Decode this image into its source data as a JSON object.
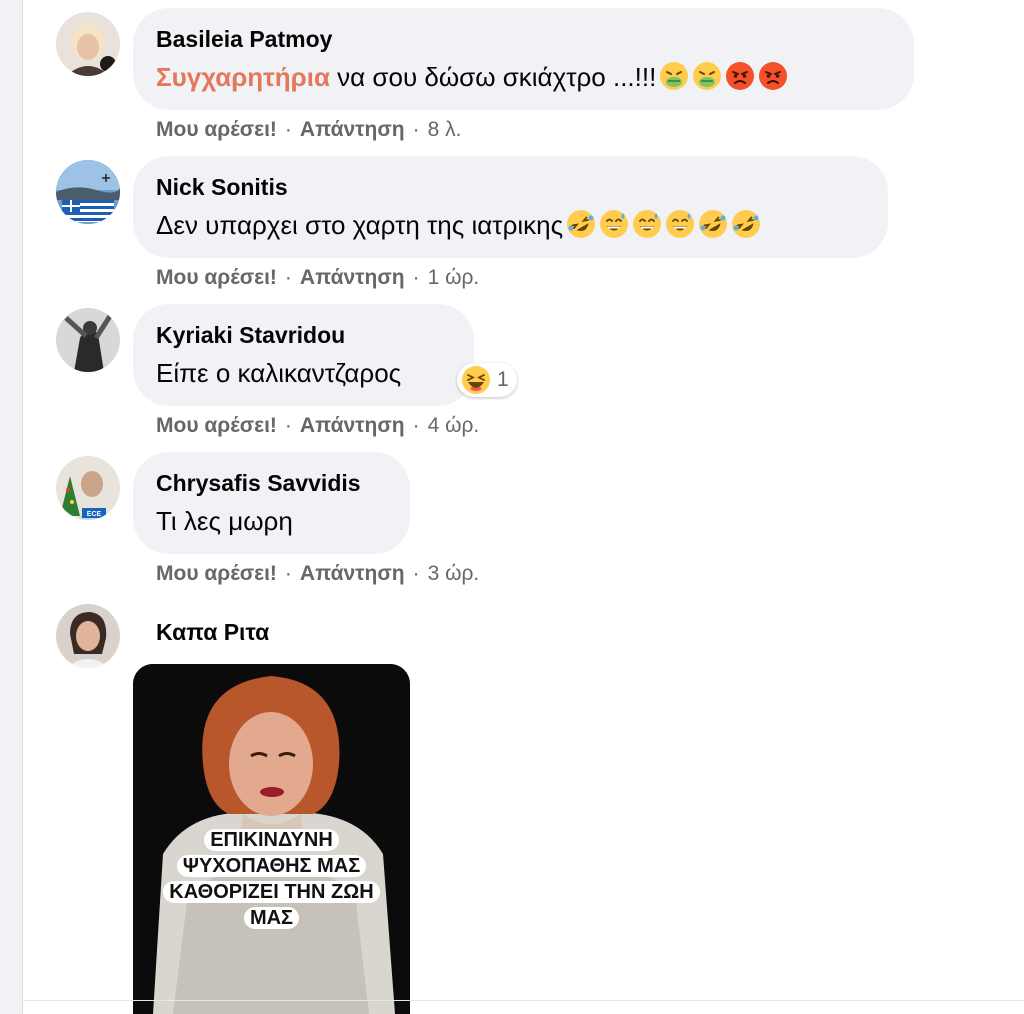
{
  "comments": [
    {
      "author": "Basileia Patmoy",
      "highlight": "Συγχαρητήρια",
      "text": " να σου δώσω σκιάχτρο ...!!!",
      "emojis": [
        "nauseated-face-emoji",
        "nauseated-face-emoji",
        "angry-face-emoji",
        "angry-face-emoji"
      ],
      "like_label": "Μου αρέσει!",
      "reply_label": "Απάντηση",
      "time": "8 λ."
    },
    {
      "author": "Nick Sonitis",
      "text": "Δεν υπαρχει στο χαρτη της ιατρικης",
      "emojis": [
        "rolling-laughing-emoji",
        "grinning-sweat-emoji",
        "grinning-sweat-emoji",
        "grinning-sweat-emoji",
        "rolling-laughing-emoji",
        "rolling-laughing-emoji"
      ],
      "like_label": "Μου αρέσει!",
      "reply_label": "Απάντηση",
      "time": "1 ώρ."
    },
    {
      "author": "Kyriaki Stavridou",
      "text": "Είπε ο καλικαντζαρος",
      "reaction": {
        "icon": "haha-reaction-icon",
        "count": "1"
      },
      "like_label": "Μου αρέσει!",
      "reply_label": "Απάντηση",
      "time": "4 ώρ."
    },
    {
      "author": "Chrysafis Savvidis",
      "text": "Τι λες μωρη",
      "like_label": "Μου αρέσει!",
      "reply_label": "Απάντηση",
      "time": "3 ώρ."
    },
    {
      "author": "Καπα Ριτα",
      "image_caption": [
        "ΕΠΙΚΙΝΔΥΝΗ",
        "ΨΥΧΟΠΑΘΗΣ ΜΑΣ",
        "ΚΑΘΟΡΙΖΕΙ ΤΗΝ ΖΩΗ",
        "ΜΑΣ"
      ]
    }
  ],
  "colors": {
    "bubble": "#f0f2f5",
    "meta_text": "#65676b",
    "highlight_text": "#e4785d",
    "emoji_yellow": "#ffcc4d",
    "emoji_angry": "#f4502a",
    "emoji_green": "#7dc462"
  }
}
